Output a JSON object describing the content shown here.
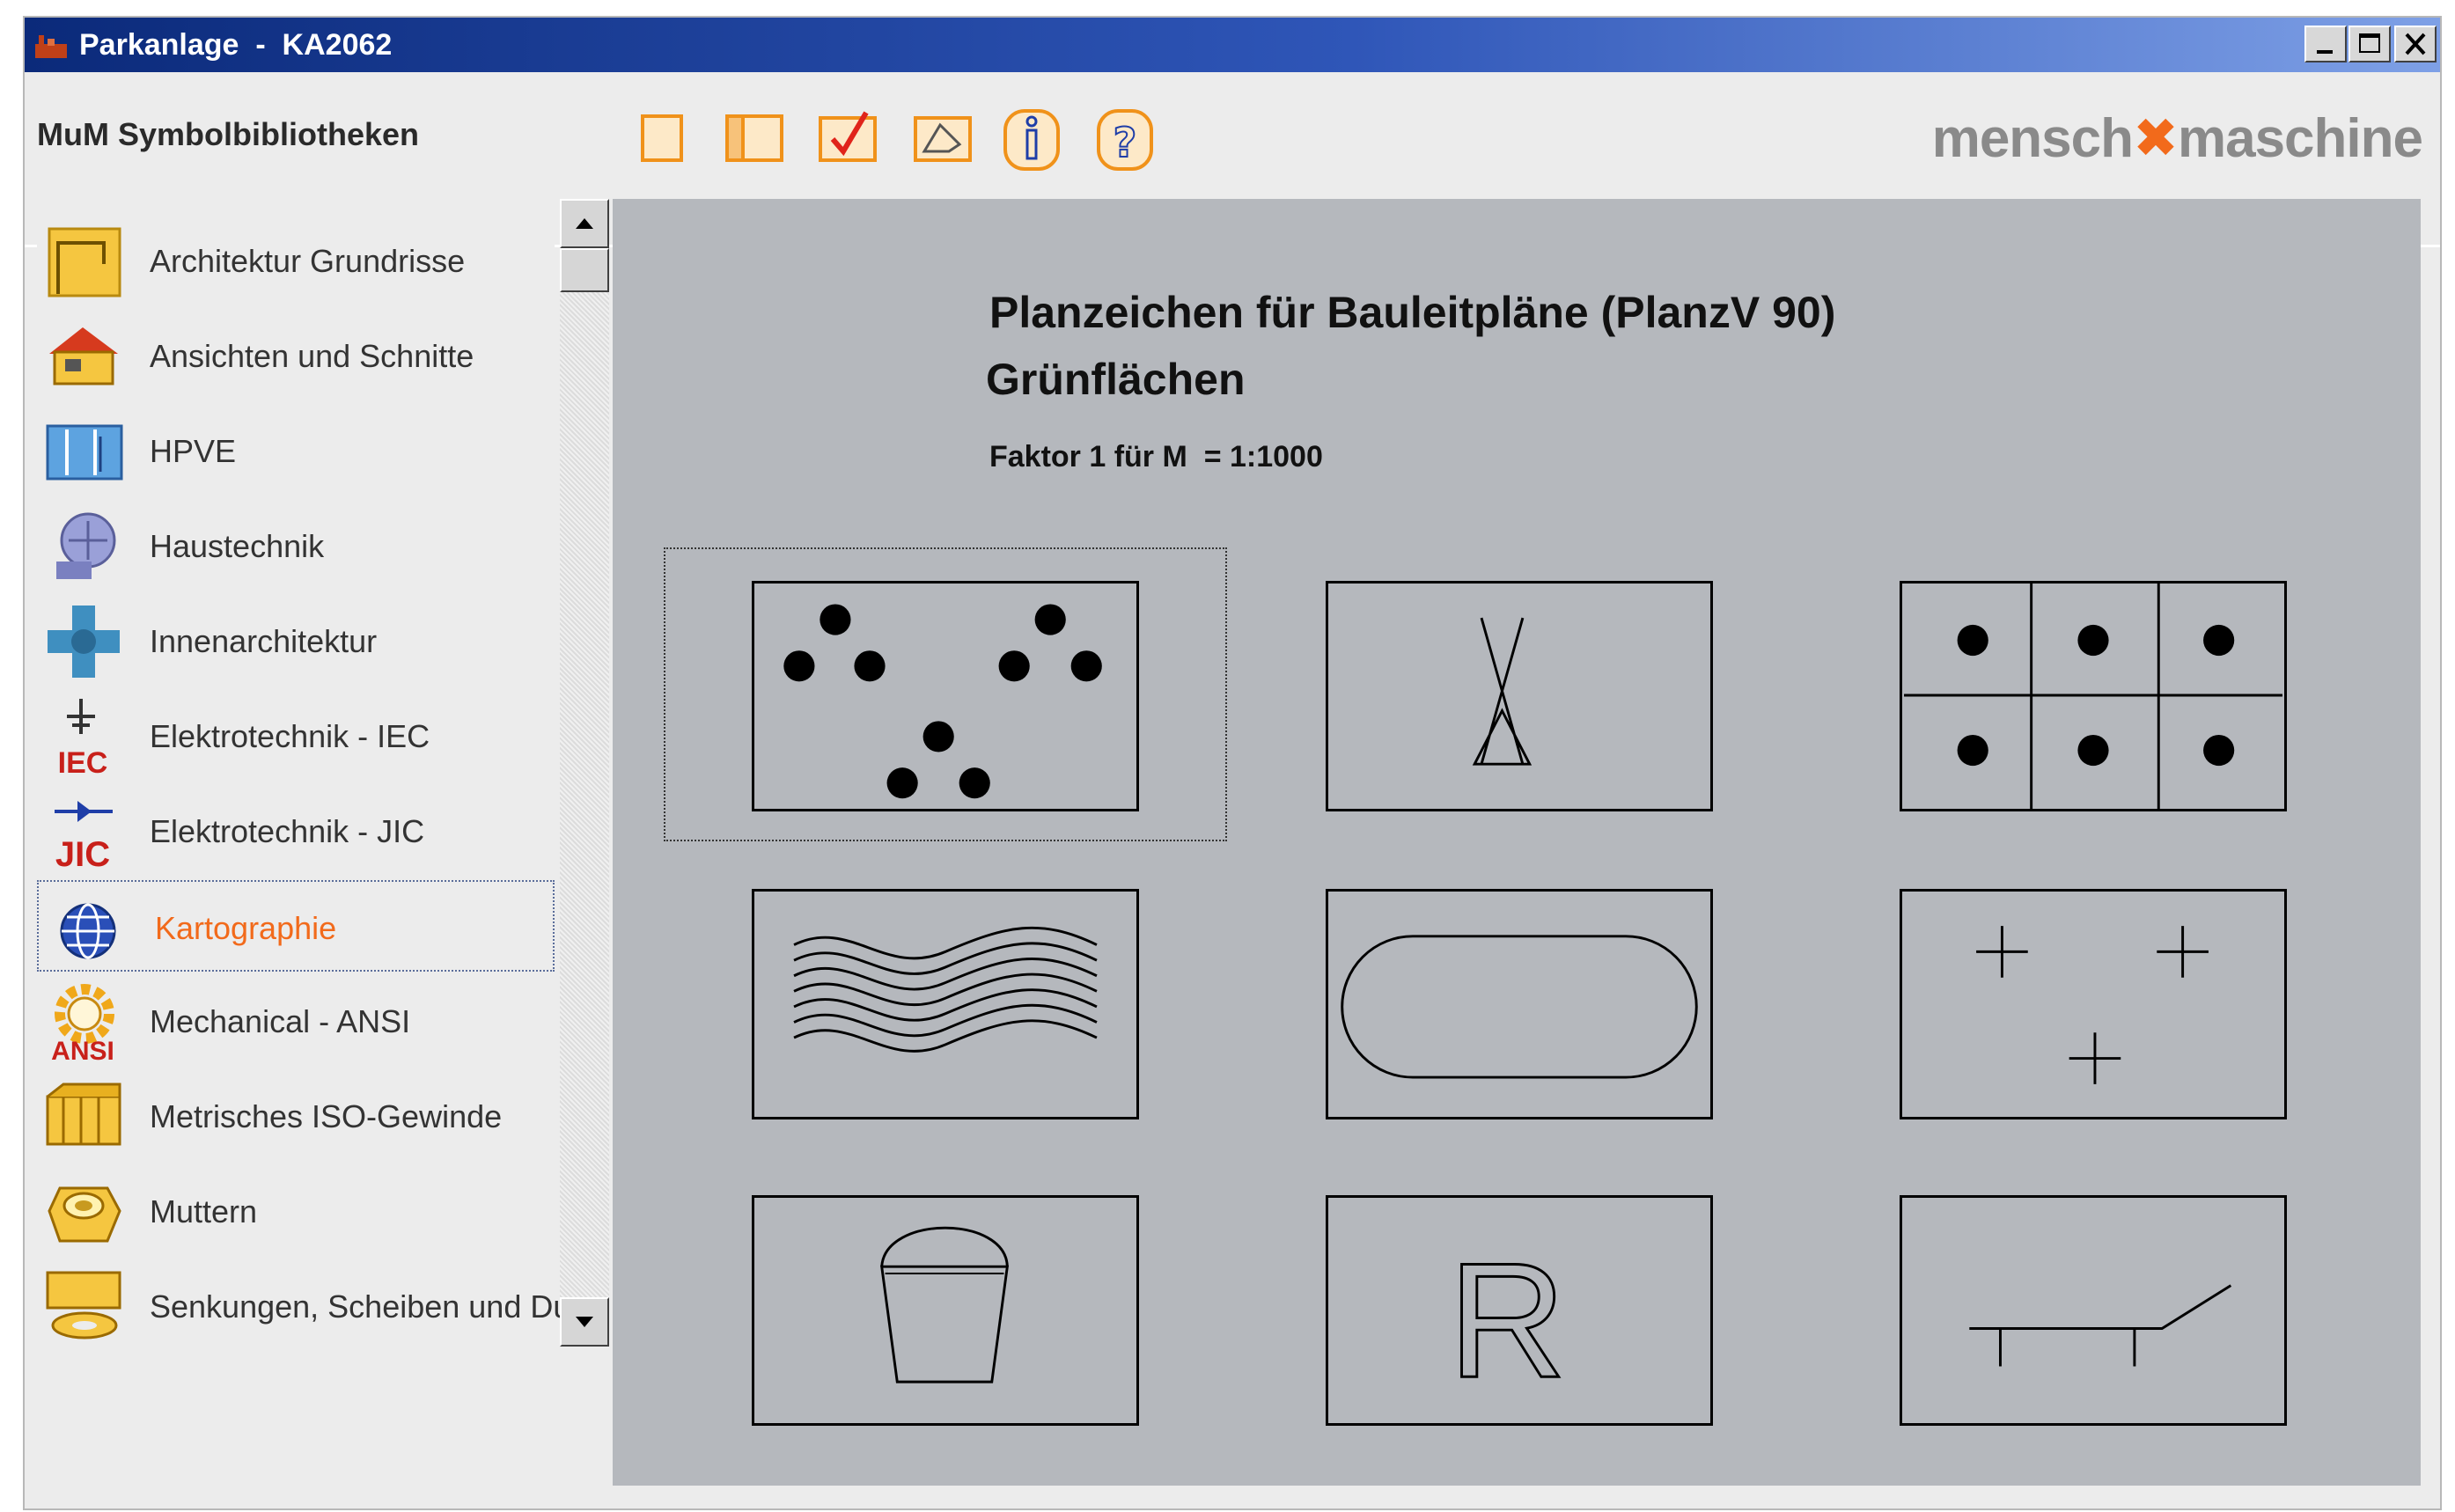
{
  "window": {
    "title": "Parkanlage  -  KA2062",
    "controls": [
      "minimize",
      "maximize",
      "close"
    ]
  },
  "header": {
    "library_title": "MuM Symbolbibliotheken",
    "toolbar": [
      {
        "icon": "blank-page-icon"
      },
      {
        "icon": "open-book-icon"
      },
      {
        "icon": "checkmark-icon"
      },
      {
        "icon": "insert-symbol-icon"
      },
      {
        "icon": "info-icon"
      },
      {
        "icon": "help-icon"
      }
    ],
    "brand": {
      "left": "mensch",
      "right": "maschine"
    }
  },
  "sidebar": {
    "items": [
      {
        "label": "Architektur Grundrisse",
        "icon": "floorplan-icon"
      },
      {
        "label": "Ansichten und Schnitte",
        "icon": "house-icon"
      },
      {
        "label": "HPVE",
        "icon": "hpve-icon"
      },
      {
        "label": "Haustechnik",
        "icon": "haustechnik-icon"
      },
      {
        "label": "Innenarchitektur",
        "icon": "interior-icon"
      },
      {
        "label": "Elektrotechnik - IEC",
        "icon": "iec-icon",
        "badge": "IEC"
      },
      {
        "label": "Elektrotechnik - JIC",
        "icon": "jic-icon",
        "badge": "JIC"
      },
      {
        "label": "Kartographie",
        "icon": "globe-icon",
        "active": true
      },
      {
        "label": "Mechanical - ANSI",
        "icon": "gear-icon",
        "badge": "ANSI"
      },
      {
        "label": "Metrisches ISO-Gewinde",
        "icon": "thread-icon"
      },
      {
        "label": "Muttern",
        "icon": "nut-icon"
      },
      {
        "label": "Senkungen, Scheiben und Du",
        "icon": "washer-icon"
      }
    ]
  },
  "main": {
    "title": "Planzeichen für Bauleitpläne (PlanzV 90)",
    "subtitle": "Grünflächen",
    "scale": "Faktor 1 für M  = 1:1000",
    "symbols": [
      {
        "name": "symbol-dots-scatter",
        "selected": true
      },
      {
        "name": "symbol-tent"
      },
      {
        "name": "symbol-grid-dots"
      },
      {
        "name": "symbol-waves"
      },
      {
        "name": "symbol-rounded-field"
      },
      {
        "name": "symbol-crosses"
      },
      {
        "name": "symbol-bucket"
      },
      {
        "name": "symbol-letter-r",
        "text": "R"
      },
      {
        "name": "symbol-lounger"
      }
    ]
  },
  "colors": {
    "accent": "#f26a1b",
    "titlebar": "#0b2a7a",
    "panel": "#b5b8bd"
  }
}
